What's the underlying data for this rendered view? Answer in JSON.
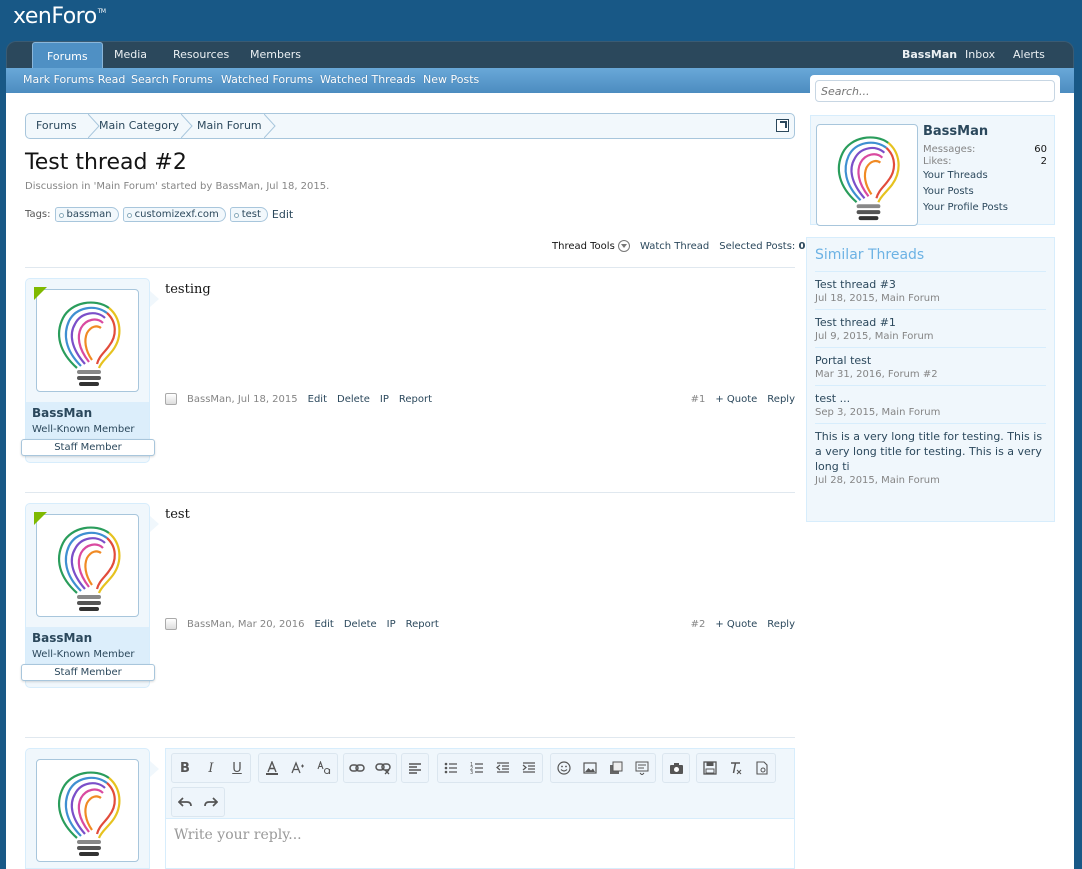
{
  "logo": {
    "text": "xenForo",
    "tm": "TM"
  },
  "nav": {
    "tabs": [
      {
        "label": "Forums"
      },
      {
        "label": "Media"
      },
      {
        "label": "Resources"
      },
      {
        "label": "Members"
      }
    ],
    "user": {
      "username": "BassMan",
      "inbox": "Inbox",
      "alerts": "Alerts"
    }
  },
  "subnav": {
    "links": [
      "Mark Forums Read",
      "Search Forums",
      "Watched Forums",
      "Watched Threads",
      "New Posts"
    ]
  },
  "search": {
    "placeholder": "Search..."
  },
  "breadcrumb": {
    "items": [
      "Forums",
      "Main Category",
      "Main Forum"
    ]
  },
  "thread": {
    "title": "Test thread #2",
    "description": "Discussion in 'Main Forum' started by BassMan, Jul 18, 2015.",
    "tags_label": "Tags:",
    "tags": [
      "bassman",
      "customizexf.com",
      "test"
    ],
    "tags_edit": "Edit",
    "tools": {
      "thread_tools": "Thread Tools",
      "watch": "Watch Thread",
      "selected": "Selected Posts:",
      "selected_count": "0"
    }
  },
  "posts": [
    {
      "body": "testing",
      "username": "BassMan",
      "user_title": "Well-Known Member",
      "banner": "Staff Member",
      "meta": "BassMan, Jul 18, 2015",
      "edit": "Edit",
      "delete": "Delete",
      "ip": "IP",
      "report": "Report",
      "number": "#1",
      "quote": "+ Quote",
      "reply": "Reply"
    },
    {
      "body": "test",
      "username": "BassMan",
      "user_title": "Well-Known Member",
      "banner": "Staff Member",
      "meta": "BassMan, Mar 20, 2016",
      "edit": "Edit",
      "delete": "Delete",
      "ip": "IP",
      "report": "Report",
      "number": "#2",
      "quote": "+ Quote",
      "reply": "Reply"
    }
  ],
  "visitor": {
    "username": "BassMan",
    "messages_label": "Messages:",
    "messages": "60",
    "likes_label": "Likes:",
    "likes": "2",
    "links": [
      "Your Threads",
      "Your Posts",
      "Your Profile Posts"
    ]
  },
  "similar": {
    "heading": "Similar Threads",
    "items": [
      {
        "title": "Test thread #3",
        "meta": "Jul 18, 2015, Main Forum"
      },
      {
        "title": "Test thread #1",
        "meta": "Jul 9, 2015, Main Forum"
      },
      {
        "title": "Portal test",
        "meta": "Mar 31, 2016, Forum #2"
      },
      {
        "title": "test ...",
        "meta": "Sep 3, 2015, Main Forum"
      },
      {
        "title": "This is a very long title for testing. This is a very long title for testing. This is a very long ti",
        "meta": "Jul 28, 2015, Main Forum"
      }
    ]
  },
  "editor": {
    "placeholder": "Write your reply...",
    "bold": "B",
    "italic": "I",
    "underline": "U"
  },
  "colors": {
    "header": "#185886",
    "nav": "#2b485c",
    "accent": "#4f90c4",
    "link": "#2b485c",
    "online": "#7fb900"
  }
}
